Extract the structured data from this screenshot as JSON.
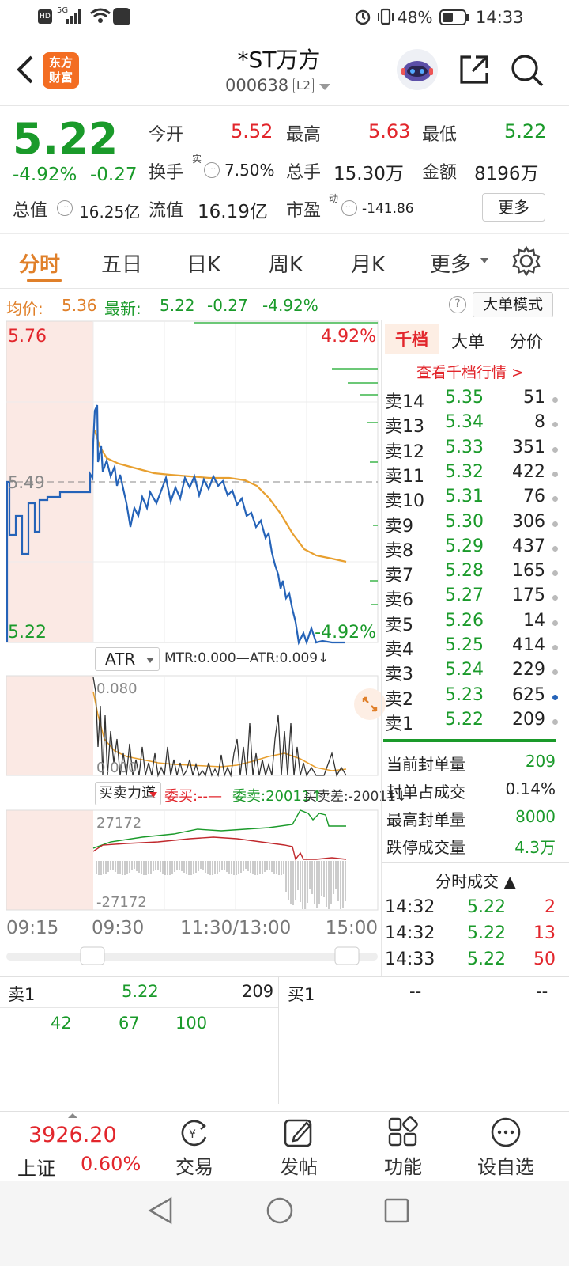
{
  "status": {
    "time": "14:33",
    "battery": "48%",
    "left_icons": "HD 5G wifi",
    "net": "5G"
  },
  "header": {
    "title": "*ST万方",
    "code": "000638",
    "level": "L2",
    "logo": "东方\n财富",
    "logo1": "东方",
    "logo2": "财富"
  },
  "quote": {
    "price": "5.22",
    "pct": "-4.92%",
    "chg": "-0.27",
    "open_label": "今开",
    "open": "5.52",
    "high_label": "最高",
    "high": "5.63",
    "low_label": "最低",
    "low": "5.22",
    "turnover_label": "换手",
    "turnover_sup": "实",
    "turnover": "7.50%",
    "vol_label": "总手",
    "vol": "15.30万",
    "amt_label": "金额",
    "amt": "8196万",
    "mcap_label": "总值",
    "mcap": "16.25亿",
    "float_label": "流值",
    "float": "16.19亿",
    "pe_label": "市盈",
    "pe_sup": "动",
    "pe": "-141.86",
    "more": "更多"
  },
  "tabs": [
    "分时",
    "五日",
    "日K",
    "周K",
    "月K",
    "更多"
  ],
  "infoline": {
    "avg_label": "均价:",
    "avg": "5.36",
    "last_label": "最新:",
    "last": "5.22",
    "chg": "-0.27",
    "pct": "-4.92%",
    "mode_btn": "大单模式"
  },
  "chart": {
    "ymax": "5.76",
    "ymid": "5.49",
    "ymin": "5.22",
    "pmax": "4.92%",
    "pmin": "-4.92%",
    "atr_name": "ATR",
    "atr_line": "MTR:0.000—ATR:0.009↓",
    "atr_max": "0.080",
    "atr_min": "0.000",
    "flow_name": "买卖力道",
    "flow_a": "委买:--—",
    "flow_b": "委卖:20011↑",
    "flow_c": "买卖差:-20011↓",
    "flow_max": "27172",
    "flow_min": "-27172",
    "times": [
      "09:15",
      "09:30",
      "11:30/13:00",
      "15:00"
    ]
  },
  "side": {
    "tabs": [
      "千档",
      "大单",
      "分价"
    ],
    "link": "查看千档行情 >",
    "asks": [
      [
        "卖14",
        "5.35",
        "51"
      ],
      [
        "卖13",
        "5.34",
        "8"
      ],
      [
        "卖12",
        "5.33",
        "351"
      ],
      [
        "卖11",
        "5.32",
        "422"
      ],
      [
        "卖10",
        "5.31",
        "76"
      ],
      [
        "卖9",
        "5.30",
        "306"
      ],
      [
        "卖8",
        "5.29",
        "437"
      ],
      [
        "卖7",
        "5.28",
        "165"
      ],
      [
        "卖6",
        "5.27",
        "175"
      ],
      [
        "卖5",
        "5.26",
        "14"
      ],
      [
        "卖4",
        "5.25",
        "414"
      ],
      [
        "卖3",
        "5.24",
        "229"
      ],
      [
        "卖2",
        "5.23",
        "625"
      ],
      [
        "卖1",
        "5.22",
        "209"
      ]
    ],
    "stats": [
      [
        "当前封单量",
        "209"
      ],
      [
        "封单占成交",
        "0.14%"
      ],
      [
        "最高封单量",
        "8000"
      ],
      [
        "跌停成交量",
        "4.3万"
      ]
    ],
    "ticks_title": "分时成交 ▲",
    "ticks": [
      [
        "14:32",
        "5.22",
        "2"
      ],
      [
        "14:32",
        "5.22",
        "13"
      ],
      [
        "14:33",
        "5.22",
        "50"
      ]
    ]
  },
  "book": {
    "sell_label": "卖1",
    "sell_price": "5.22",
    "sell_vol": "209",
    "buy_label": "买1",
    "buy_price": "--",
    "buy_vol": "--",
    "queue": [
      "42",
      "67",
      "100"
    ]
  },
  "bottom": {
    "index_val": "3926.20",
    "index_name": "上证",
    "index_pct": "0.60%",
    "items": [
      "交易",
      "发帖",
      "功能",
      "设自选"
    ]
  },
  "colors": {
    "red": "#e2262c",
    "green": "#1a9a2a",
    "orange": "#e0802a",
    "blue": "#2563b8"
  }
}
